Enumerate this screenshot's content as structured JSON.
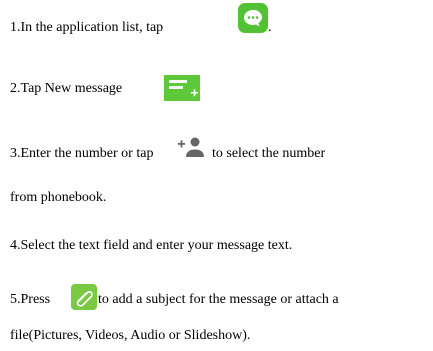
{
  "steps": [
    {
      "id": "step1",
      "text": "1.In the application list, tap",
      "suffix": ".",
      "icon": "messaging-app-icon"
    },
    {
      "id": "step2",
      "text": "2.Tap New message",
      "icon": "new-message-icon"
    },
    {
      "id": "step3",
      "text_before": "3.Enter the number or tap",
      "text_after": "to select the number",
      "icon": "add-contact-icon"
    },
    {
      "id": "step3b",
      "text": "from phonebook."
    },
    {
      "id": "step4",
      "text": "4.Select the text field and enter your message text."
    },
    {
      "id": "step5",
      "text_before": "5.Press",
      "text_after": "to add a subject for the message or attach a",
      "icon": "paperclip-attach-icon"
    },
    {
      "id": "step5b",
      "text": "file(Pictures, Videos, Audio or Slideshow)."
    }
  ],
  "colors": {
    "app_icon_green": "#52c234",
    "app_icon_bubble": "#ffffff",
    "new_message_green": "#5cc83a",
    "contact_gray": "#666666",
    "attach_green": "#7ac943"
  }
}
